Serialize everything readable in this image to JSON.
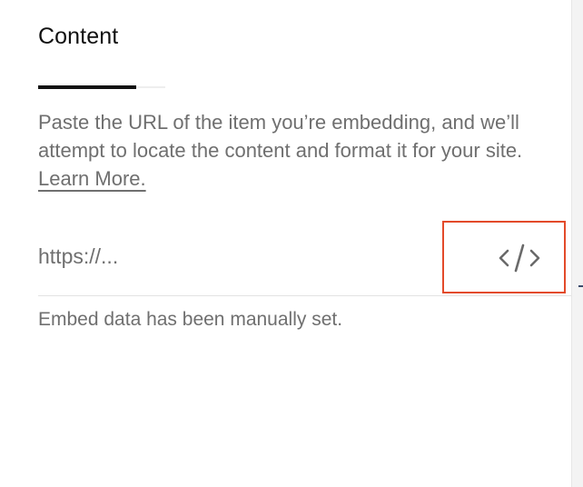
{
  "panel": {
    "tab_title": "Content",
    "description_text": "Paste the URL of the item you’re embedding, and we’ll attempt to locate the content and format it for your site. ",
    "learn_more_label": "Learn More.",
    "url_input": {
      "placeholder": "https://...",
      "value": ""
    },
    "embed_code_button": {
      "icon": "code-icon",
      "highlight_color": "#e34a2a"
    },
    "status_text": "Embed data has been manually set."
  }
}
